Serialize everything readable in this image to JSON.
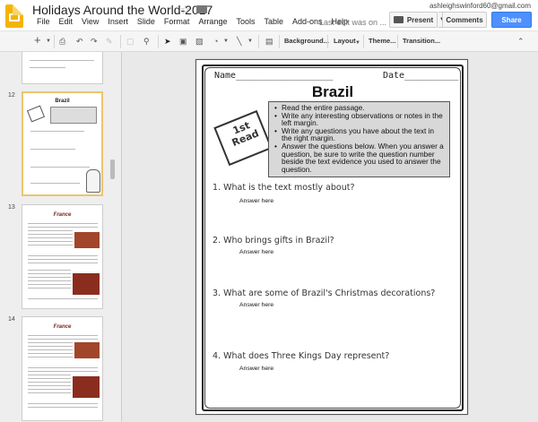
{
  "app": {
    "title": "Holidays Around the World-2017",
    "email": "ashleighswinford60@gmail.com",
    "last_edit": "Last edit was on ...",
    "present_label": "Present",
    "comments_label": "Comments",
    "share_label": "Share"
  },
  "menu": [
    "File",
    "Edit",
    "View",
    "Insert",
    "Slide",
    "Format",
    "Arrange",
    "Tools",
    "Table",
    "Add-ons",
    "Help"
  ],
  "toolbar": {
    "background": "Background...",
    "layout": "Layout",
    "theme": "Theme...",
    "transition": "Transition..."
  },
  "filmstrip": {
    "slides": [
      {
        "number": "12",
        "title": "Brazil"
      },
      {
        "number": "13",
        "title": "France"
      },
      {
        "number": "14",
        "title": "France"
      }
    ]
  },
  "slide": {
    "name_label": "Name__________________",
    "date_label": "Date__________",
    "title": "Brazil",
    "badge_line1": "1st",
    "badge_line2": "Read",
    "instructions": [
      "Read the entire passage.",
      "Write any interesting observations or notes in the left margin.",
      "Write any questions you have about the text in the right margin.",
      "Answer the questions below.  When you answer a question, be sure to write the question number beside the text evidence you used to answer the question."
    ],
    "questions": [
      {
        "q": "1.  What is the text mostly about?",
        "a": "Answer here"
      },
      {
        "q": "2.  Who brings gifts in Brazil?",
        "a": "Answer here"
      },
      {
        "q": "3.  What are some of Brazil's Christmas decorations?",
        "a": "Answer here"
      },
      {
        "q": "4.  What does Three Kings Day represent?",
        "a": "Answer here"
      }
    ]
  },
  "colors": {
    "share": "#4d90fe",
    "logo": "#f4b400",
    "selected_thumb": "#f0c36d"
  }
}
